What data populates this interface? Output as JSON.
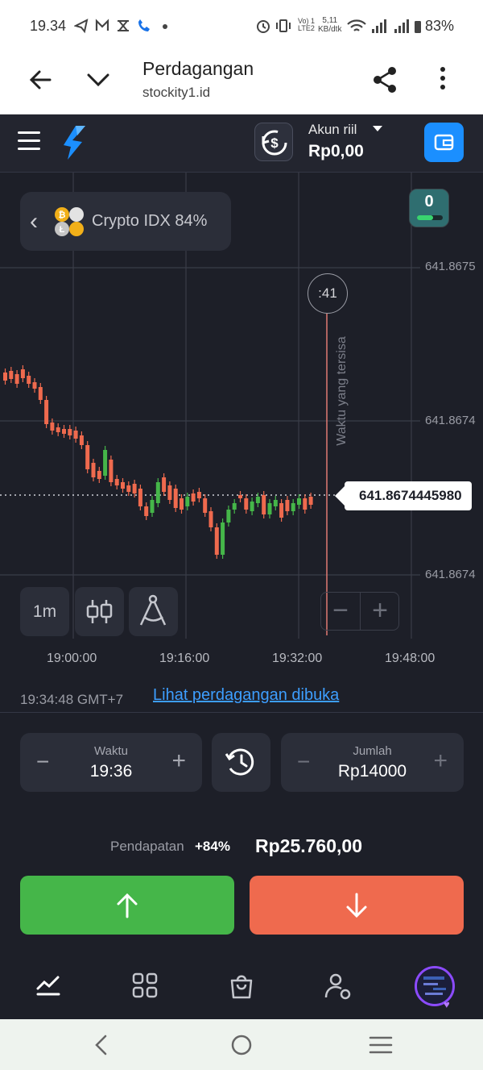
{
  "status_bar": {
    "time": "19.34",
    "net_label_top": "Vo) 1",
    "net_label_bottom": "LTE2",
    "speed_top": "5,11",
    "speed_bottom": "KB/dtk",
    "battery": "83%"
  },
  "browser": {
    "title": "Perdagangan",
    "url": "stockity1.id"
  },
  "account": {
    "name": "Akun riil",
    "balance": "Rp0,00"
  },
  "asset": {
    "name": "Crypto IDX 84%"
  },
  "badge": {
    "count": "0"
  },
  "chart": {
    "price_levels": [
      "641.8675",
      "641.8674",
      "641.8674"
    ],
    "timer": ":41",
    "remaining_label": "Waktu yang tersisa",
    "current_price": "641.8674445980",
    "timeframe": "1m",
    "x_labels": [
      "19:00:00",
      "19:16:00",
      "19:32:00",
      "19:48:00"
    ],
    "zoom_minus": "−",
    "zoom_plus": "+"
  },
  "info": {
    "clock": "19:34:48 GMT+7",
    "open_trades_link": "Lihat perdagangan dibuka"
  },
  "trade": {
    "time_label": "Waktu",
    "time_value": "19:36",
    "amount_label": "Jumlah",
    "amount_value": "Rp14000",
    "minus": "−",
    "plus": "+",
    "income_label": "Pendapatan",
    "income_percent": "+84%",
    "income_value": "Rp25.760,00"
  },
  "colors": {
    "up": "#45b649",
    "down": "#ef6a4e",
    "accent": "#1b8fff",
    "background": "#1d1f28"
  }
}
